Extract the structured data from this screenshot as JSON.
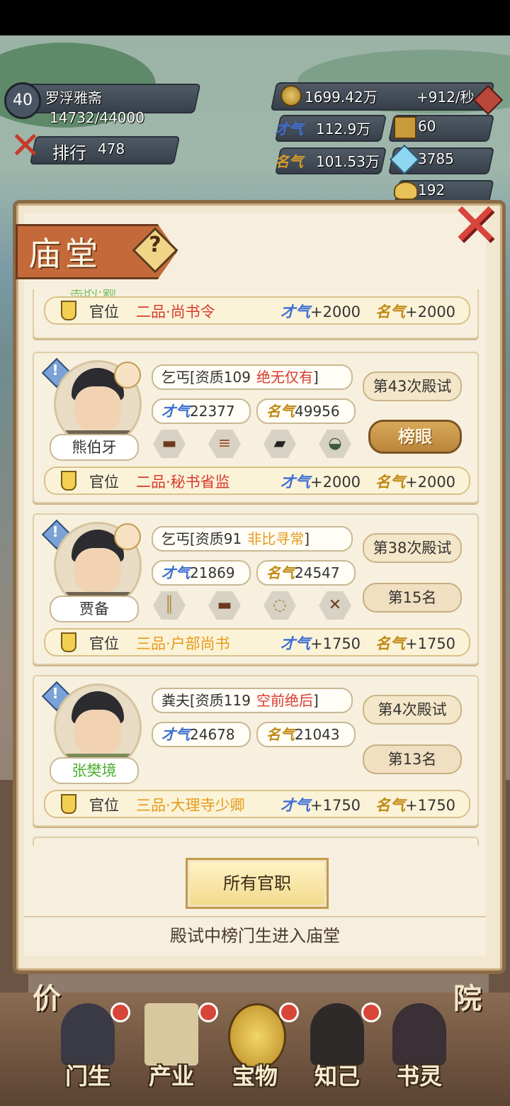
{
  "hud": {
    "level": "40",
    "player_name": "罗浮雅斋",
    "exp": "14732/44000",
    "rank_label": "排行",
    "rank_value": "478",
    "money": "1699.42万",
    "money_rate": "+912/秒",
    "talent_value": "112.9万",
    "gold_seal_value": "60",
    "fame_value": "101.53万",
    "gem_value": "3785",
    "ingot_value": "192"
  },
  "panel": {
    "title": "庙堂",
    "help_glyph": "?",
    "close_glyph": "✕",
    "partial_top_name": "羔的·赖",
    "top_office": {
      "label": "官位",
      "title": "二品·尚书令",
      "title_color": "#d83a2e",
      "talent": "+2000",
      "fame": "+2000"
    },
    "cards": [
      {
        "name": "熊伯牙",
        "name_color": "#333333",
        "has_consort": true,
        "origin": "乞丐[资质109",
        "grade": "绝无仅有",
        "grade_close": "]",
        "grade_color": "#d83a2e",
        "talent": "22377",
        "fame": "49956",
        "exam": "第43次殿试",
        "result_type": "honor",
        "result": "榜眼",
        "items": [
          "zither-icon",
          "scroll-icon",
          "inkstick-icon",
          "inkstone-icon"
        ],
        "office": {
          "label": "官位",
          "title": "二品·秘书省监",
          "title_color": "#d83a2e",
          "talent": "+2000",
          "fame": "+2000"
        }
      },
      {
        "name": "贾备",
        "name_color": "#333333",
        "has_consort": true,
        "origin": "乞丐[资质91",
        "grade": "非比寻常",
        "grade_close": "]",
        "grade_color": "#e69a1a",
        "talent": "21869",
        "fame": "24547",
        "exam": "第38次殿试",
        "result_type": "rank",
        "result": "第15名",
        "items": [
          "bamboo-slips-icon",
          "zither-icon",
          "prayer-beads-icon",
          "brushes-icon"
        ],
        "office": {
          "label": "官位",
          "title": "三品·户部尚书",
          "title_color": "#e69a1a",
          "talent": "+1750",
          "fame": "+1750"
        }
      },
      {
        "name": "张樊境",
        "name_color": "#4caf2f",
        "has_consort": false,
        "origin": "粪夫[资质119",
        "grade": "空前绝后",
        "grade_close": "]",
        "grade_color": "#d83a2e",
        "talent": "24678",
        "fame": "21043",
        "exam": "第4次殿试",
        "result_type": "rank",
        "result": "第13名",
        "items": [],
        "office": {
          "label": "官位",
          "title": "三品·大理寺少卿",
          "title_color": "#e69a1a",
          "talent": "+1750",
          "fame": "+1750"
        }
      }
    ],
    "talent_tag": "才气",
    "fame_tag": "名气",
    "all_offices_button": "所有官职",
    "footer_note": "殿试中榜门生进入庙堂"
  },
  "bottom_nav": [
    {
      "label": "门生",
      "icon": "student-icon"
    },
    {
      "label": "产业",
      "icon": "map-icon"
    },
    {
      "label": "宝物",
      "icon": "compass-icon"
    },
    {
      "label": "知己",
      "icon": "confidant-icon"
    },
    {
      "label": "书灵",
      "icon": "book-spirit-icon"
    }
  ],
  "side_labels": {
    "left": "价",
    "right": "院"
  }
}
